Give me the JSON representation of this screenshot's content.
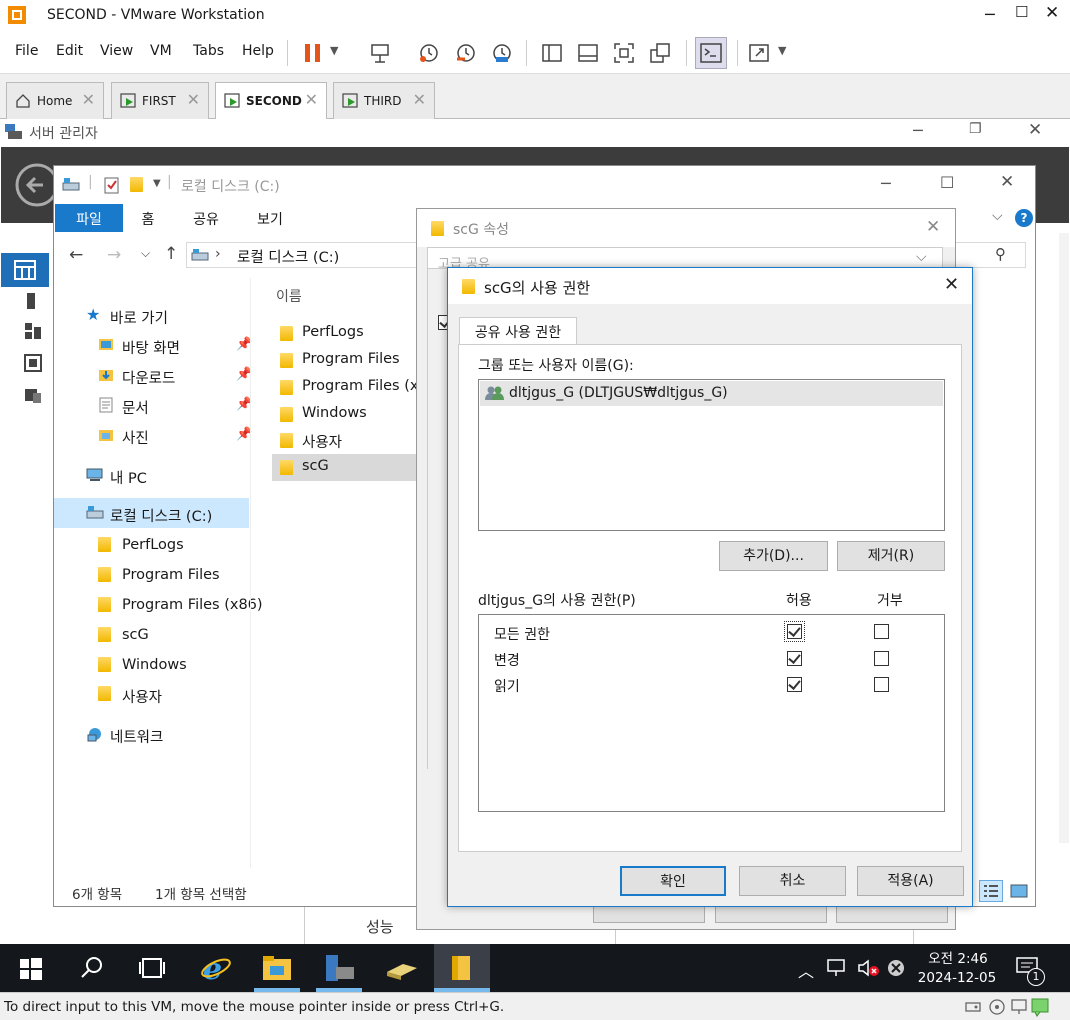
{
  "vmware": {
    "window_title": "SECOND - VMware Workstation",
    "menu": [
      "File",
      "Edit",
      "View",
      "VM",
      "Tabs",
      "Help"
    ],
    "tabs": [
      {
        "label": "Home",
        "active": false
      },
      {
        "label": "FIRST",
        "active": false
      },
      {
        "label": "SECOND",
        "active": true
      },
      {
        "label": "THIRD",
        "active": false
      }
    ],
    "status_text": "To direct input to this VM, move the mouse pointer inside or press Ctrl+G."
  },
  "server_manager": {
    "title": "서버 관리자",
    "bottom_label": "성능"
  },
  "explorer": {
    "title": "로컬 디스크 (C:)",
    "ribbon_tabs": [
      "파일",
      "홈",
      "공유",
      "보기"
    ],
    "address": "로컬 디스크 (C:)",
    "column_header": "이름",
    "nav": {
      "quick_access": "바로 가기",
      "pinned": [
        "바탕 화면",
        "다운로드",
        "문서",
        "사진"
      ],
      "this_pc": "내 PC",
      "local_disk": "로컬 디스크 (C:)",
      "folders": [
        "PerfLogs",
        "Program Files",
        "Program Files (x86)",
        "scG",
        "Windows",
        "사용자"
      ],
      "network": "네트워크"
    },
    "files": [
      "PerfLogs",
      "Program Files",
      "Program Files (x8",
      "Windows",
      "사용자",
      "scG"
    ],
    "status_count": "6개 항목",
    "status_selected": "1개 항목 선택함"
  },
  "properties_dialog": {
    "title": "scG 속성",
    "tab_partial": "고급 공유"
  },
  "permission_dialog": {
    "title": "scG의 사용 권한",
    "tab": "공유 사용 권한",
    "group_label": "그룹 또는 사용자 이름(G):",
    "users": [
      "dltjgus_G (DLTJGUS₩dltjgus_G)"
    ],
    "add_button": "추가(D)...",
    "remove_button": "제거(R)",
    "perm_label": "dltjgus_G의 사용 권한(P)",
    "allow_header": "허용",
    "deny_header": "거부",
    "permissions": [
      {
        "name": "모든 권한",
        "allow": true,
        "deny": false
      },
      {
        "name": "변경",
        "allow": true,
        "deny": false
      },
      {
        "name": "읽기",
        "allow": true,
        "deny": false
      }
    ],
    "ok_button": "확인",
    "cancel_button": "취소",
    "apply_button": "적용(A)"
  },
  "taskbar": {
    "time": "오전 2:46",
    "date": "2024-12-05",
    "notification_count": "1"
  }
}
